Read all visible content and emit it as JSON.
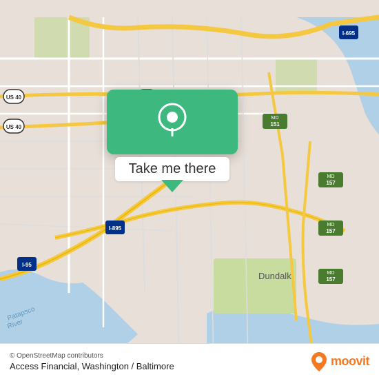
{
  "map": {
    "bg_color": "#e8e0d8",
    "water_color": "#b0d0e8",
    "road_yellow": "#f5c842",
    "road_white": "#ffffff",
    "road_gray": "#cccccc",
    "park_color": "#c8dca0"
  },
  "popup": {
    "label": "Take me there",
    "bg_color": "#3db87e",
    "icon": "map-pin-icon"
  },
  "bottom_bar": {
    "osm_credit": "© OpenStreetMap contributors",
    "location": "Access Financial, Washington / Baltimore",
    "logo_text": "moovit"
  }
}
